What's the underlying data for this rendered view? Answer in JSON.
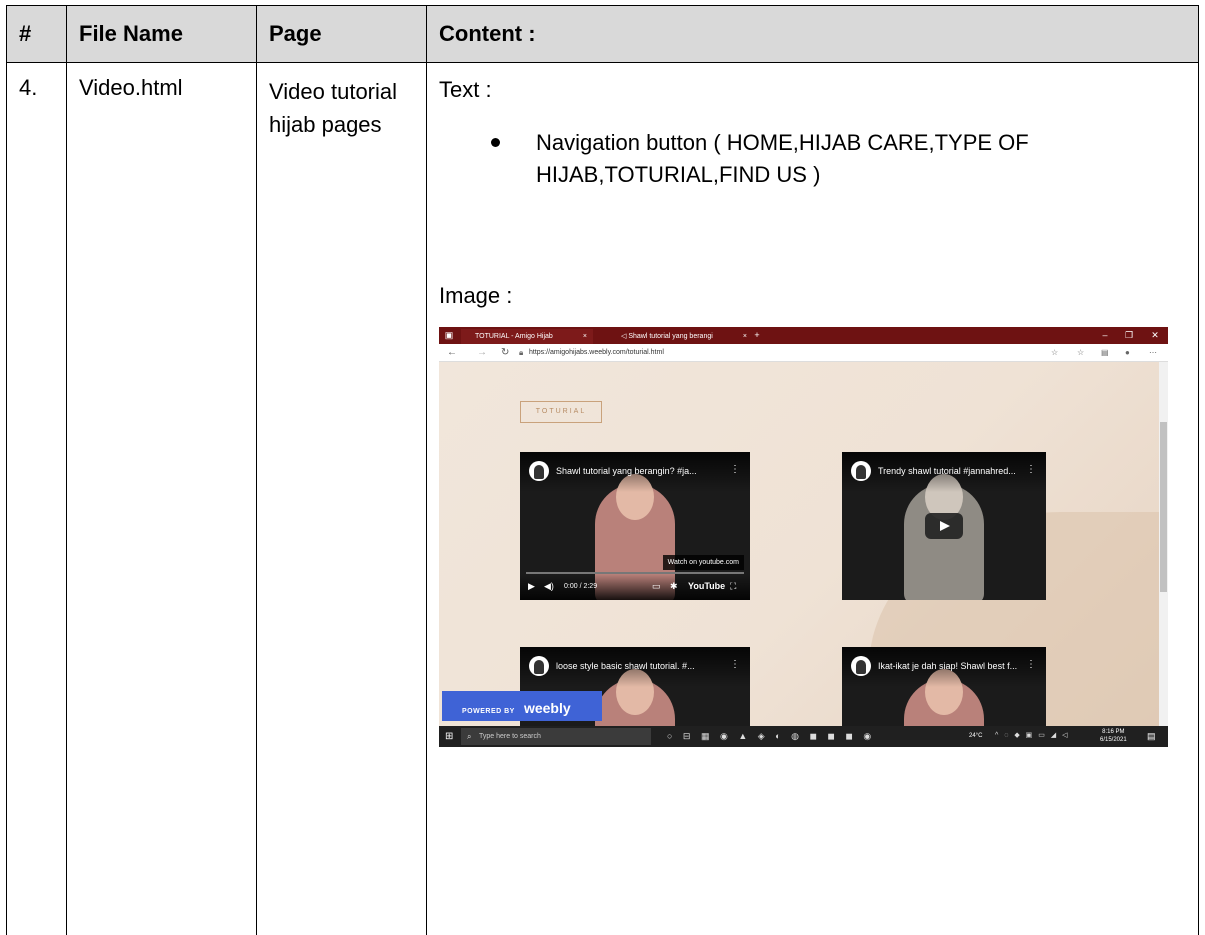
{
  "table": {
    "headers": [
      "#",
      "File Name",
      "Page",
      "Content :"
    ],
    "row": {
      "number": "4.",
      "file_name": "Video.html",
      "page": "Video tutorial hijab pages",
      "text_heading": "Text :",
      "bullets": [
        "Navigation button ( HOME,HIJAB CARE,TYPE OF HIJAB,TOTURIAL,FIND US )"
      ],
      "image_heading": "Image :"
    }
  },
  "screenshot": {
    "tabs": [
      {
        "label": "TOTURIAL - Amigo Hijab"
      },
      {
        "label": "Shawl tutorial yang berangi"
      }
    ],
    "close_glyph": "×",
    "new_tab_glyph": "+",
    "window_controls": [
      "–",
      "❐",
      "✕"
    ],
    "url": "https://amigohijabs.weebly.com/toturial.html",
    "section_label": "TOTURIAL",
    "videos": [
      {
        "title": "Shawl tutorial yang berangin? #ja...",
        "time": "0:00 / 2:29",
        "watch_label": "Watch on youtube.com",
        "brand": "YouTube"
      },
      {
        "title": "Trendy shawl tutorial #jannahred..."
      },
      {
        "title": "loose style basic shawl tutorial. #..."
      },
      {
        "title": "Ikat-ikat je dah siap! Shawl best f..."
      }
    ],
    "weebly": {
      "powered_by": "POWERED BY",
      "brand": "weebly"
    },
    "taskbar": {
      "search_placeholder": "Type here to search",
      "temperature": "24°C",
      "time": "8:16 PM",
      "date": "6/15/2021"
    },
    "colors": {
      "titlebar": "#6e1212",
      "weebly": "#3f63d6",
      "taskbar": "#202020",
      "page_bg": "#efe3d7"
    }
  }
}
